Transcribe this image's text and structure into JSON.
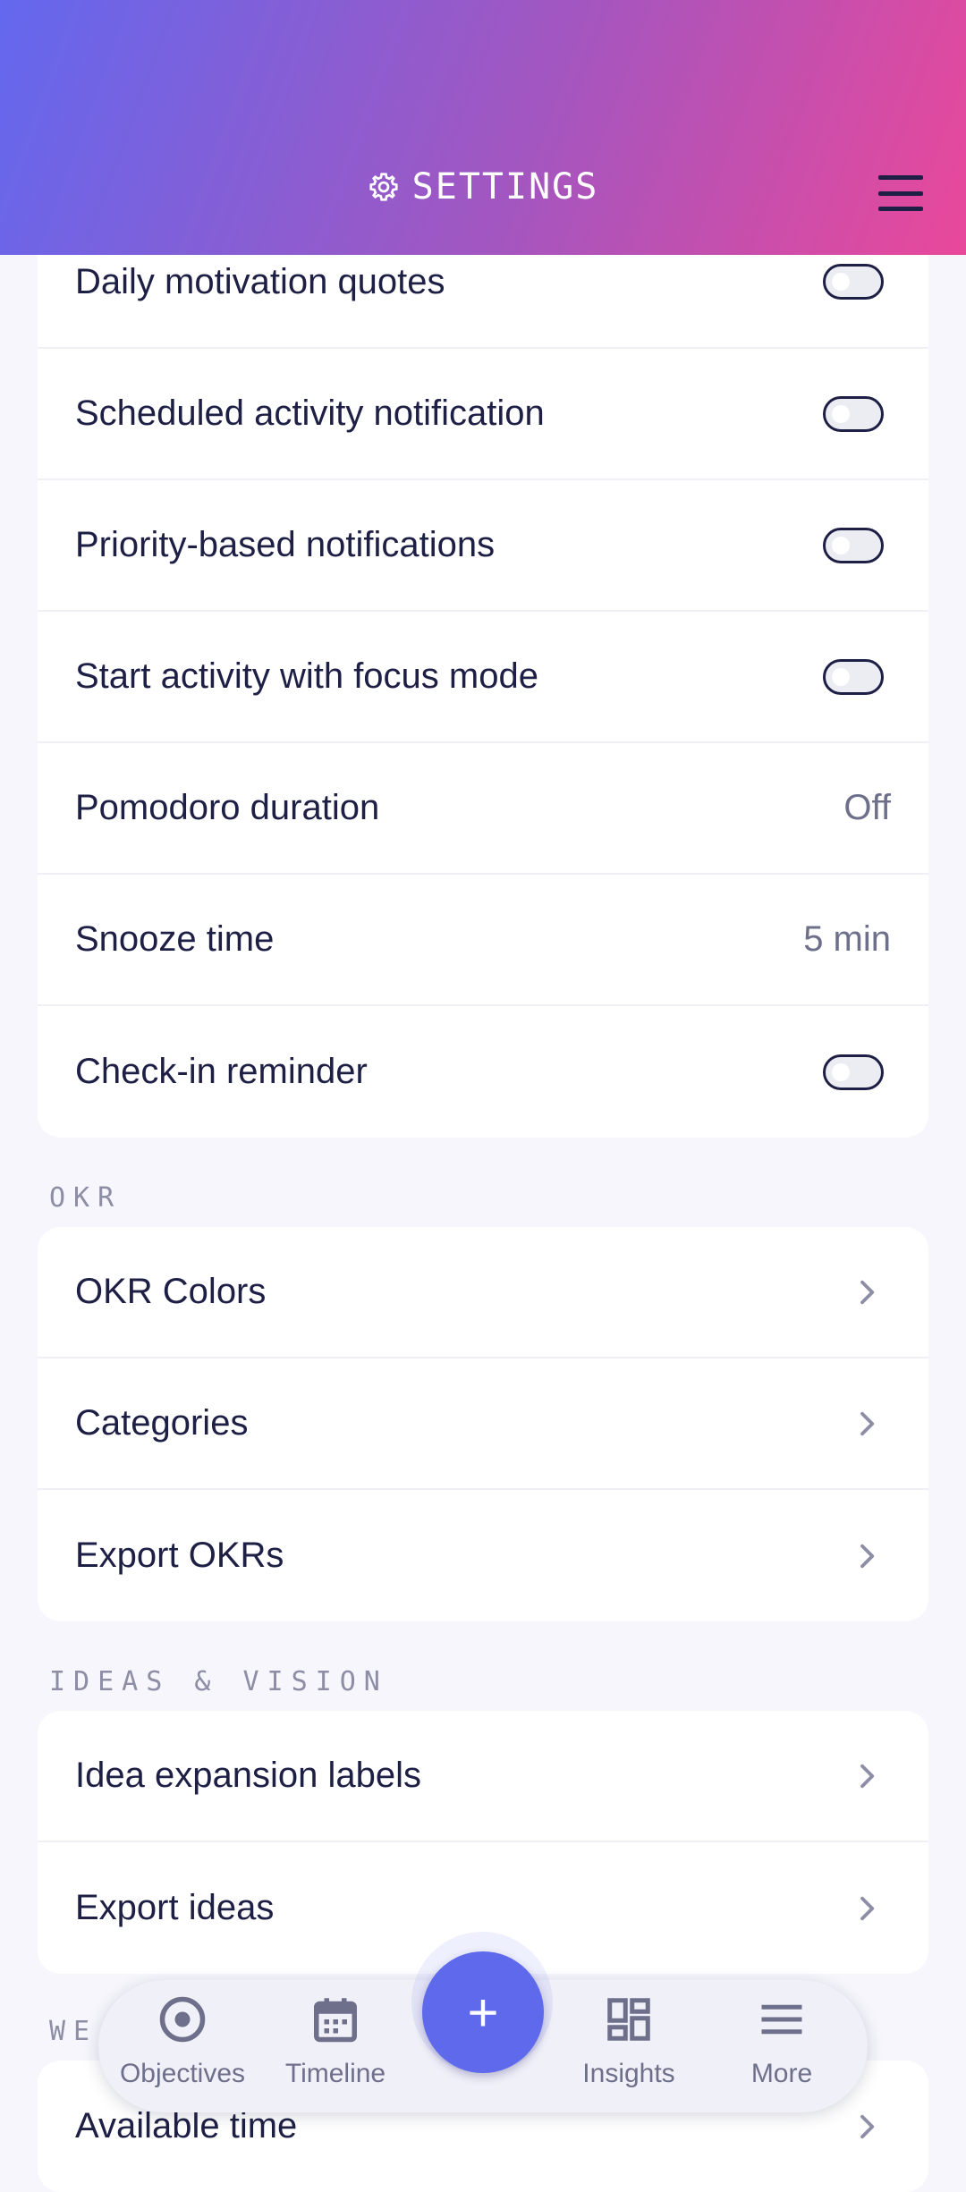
{
  "header": {
    "title": "SETTINGS",
    "icon": "gear-icon",
    "menu_icon": "hamburger-menu-icon"
  },
  "notifications": {
    "items": [
      {
        "label": "Daily motivation quotes",
        "type": "toggle",
        "on": false
      },
      {
        "label": "Scheduled activity notification",
        "type": "toggle",
        "on": false
      },
      {
        "label": "Priority-based notifications",
        "type": "toggle",
        "on": false
      },
      {
        "label": "Start activity with focus mode",
        "type": "toggle",
        "on": false
      },
      {
        "label": "Pomodoro duration",
        "type": "value",
        "value": "Off"
      },
      {
        "label": "Snooze time",
        "type": "value",
        "value": "5 min"
      },
      {
        "label": "Check-in reminder",
        "type": "toggle",
        "on": false
      }
    ]
  },
  "okr": {
    "section_title": "OKR",
    "items": [
      {
        "label": "OKR Colors"
      },
      {
        "label": "Categories"
      },
      {
        "label": "Export OKRs"
      }
    ]
  },
  "ideas": {
    "section_title": "IDEAS & VISION",
    "items": [
      {
        "label": "Idea expansion labels"
      },
      {
        "label": "Export ideas"
      }
    ]
  },
  "week": {
    "section_title": "WE",
    "items": [
      {
        "label": "Available time"
      }
    ]
  },
  "bottom_nav": {
    "items": [
      {
        "label": "Objectives",
        "icon": "target-icon"
      },
      {
        "label": "Timeline",
        "icon": "calendar-icon"
      },
      {
        "label": "Insights",
        "icon": "dashboard-icon"
      },
      {
        "label": "More",
        "icon": "menu-icon"
      }
    ],
    "fab_label": "+",
    "fab_icon": "plus-icon"
  },
  "colors": {
    "accent": "#5f69ec",
    "gradient_start": "#6368ee",
    "gradient_end": "#e9489a",
    "text": "#1e1f45",
    "muted": "#8d8ea6"
  }
}
